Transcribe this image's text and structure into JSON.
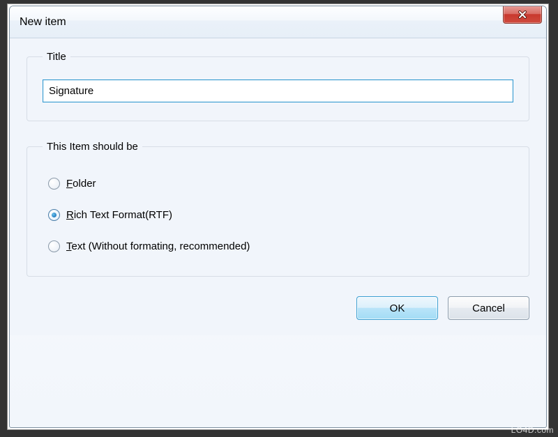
{
  "window": {
    "title": "New item"
  },
  "groups": {
    "title_legend": "Title",
    "type_legend": "This Item should be"
  },
  "form": {
    "title_value": "Signature"
  },
  "options": {
    "folder": {
      "accel": "F",
      "rest": "older"
    },
    "rtf": {
      "accel": "R",
      "rest": "ich Text Format(RTF)"
    },
    "text": {
      "accel": "T",
      "rest": "ext (Without formating, recommended)"
    },
    "selected": "rtf"
  },
  "buttons": {
    "ok": "OK",
    "cancel": "Cancel"
  },
  "watermark": "LO4D.com"
}
